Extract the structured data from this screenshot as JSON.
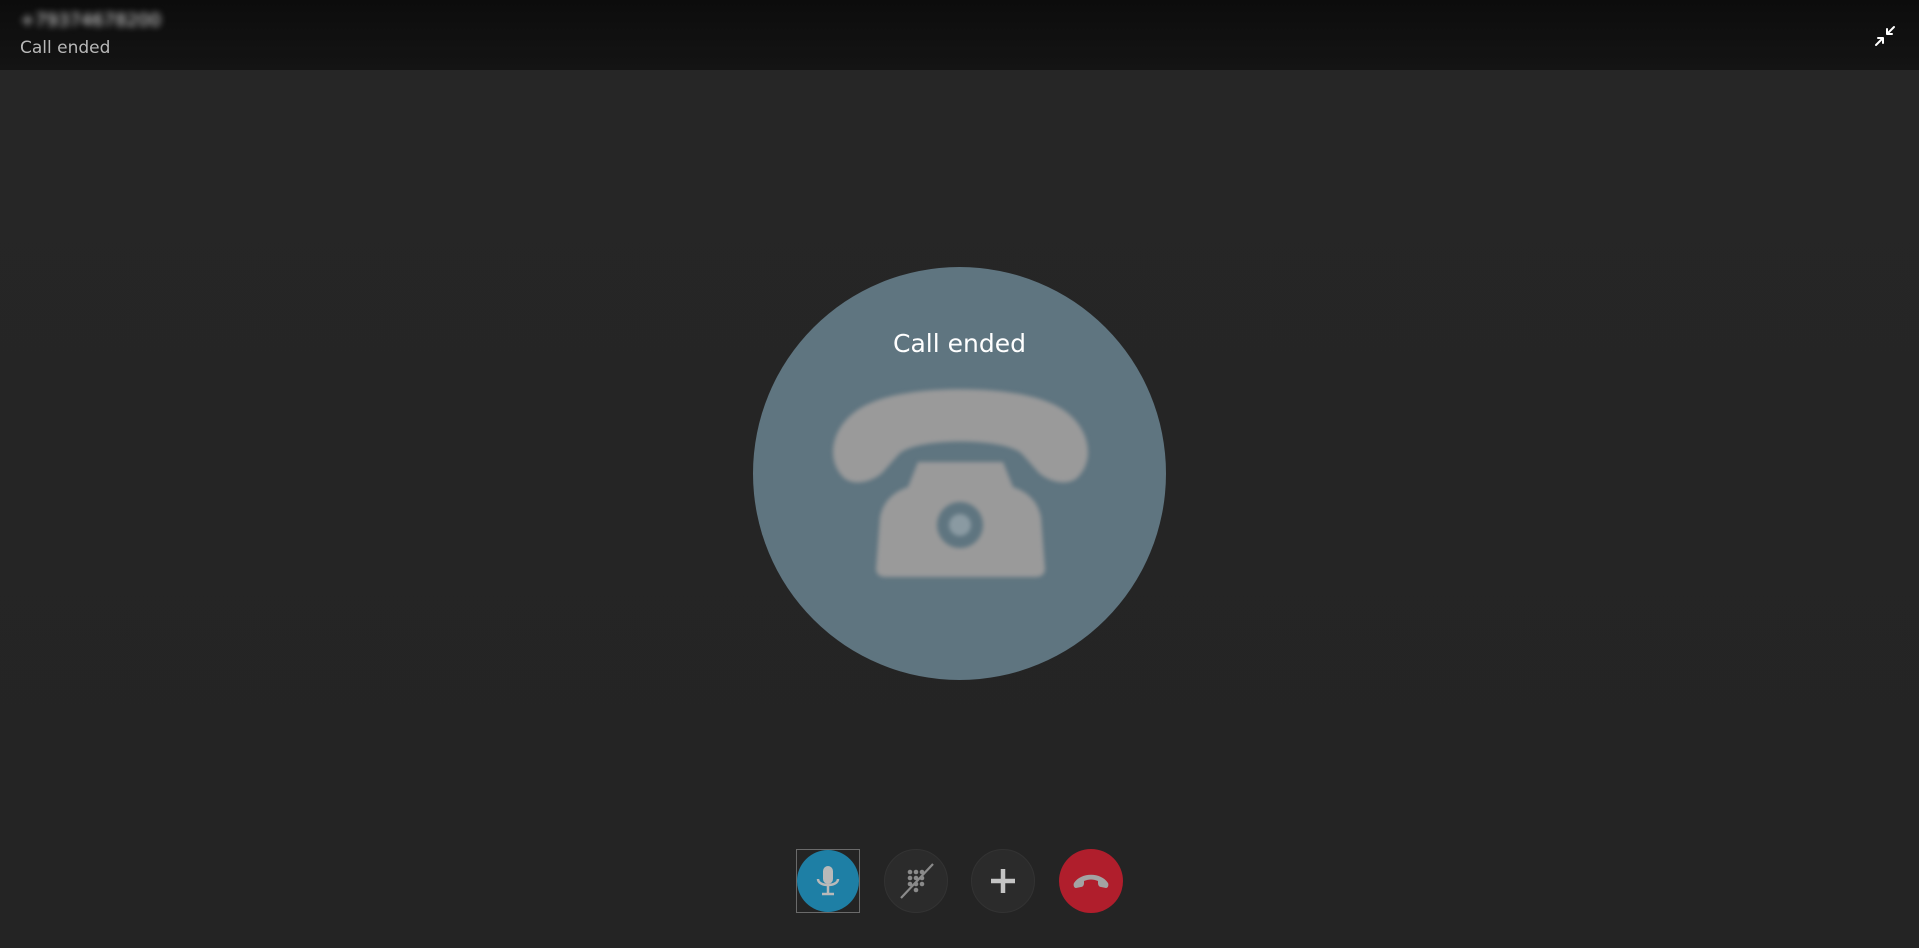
{
  "header": {
    "caller_id": "+79374678200",
    "status": "Call ended"
  },
  "avatar": {
    "status": "Call ended"
  },
  "icons": {
    "minimize": "minimize-arrows-icon",
    "phone": "phone-icon",
    "mic": "microphone-icon",
    "dialpad": "dialpad-disabled-icon",
    "add": "plus-icon",
    "hangup": "hang-up-icon"
  },
  "colors": {
    "avatar_bg": "#5f7580",
    "mic_active": "#1e7fa5",
    "hangup": "#b01e2c",
    "background": "#252525"
  }
}
